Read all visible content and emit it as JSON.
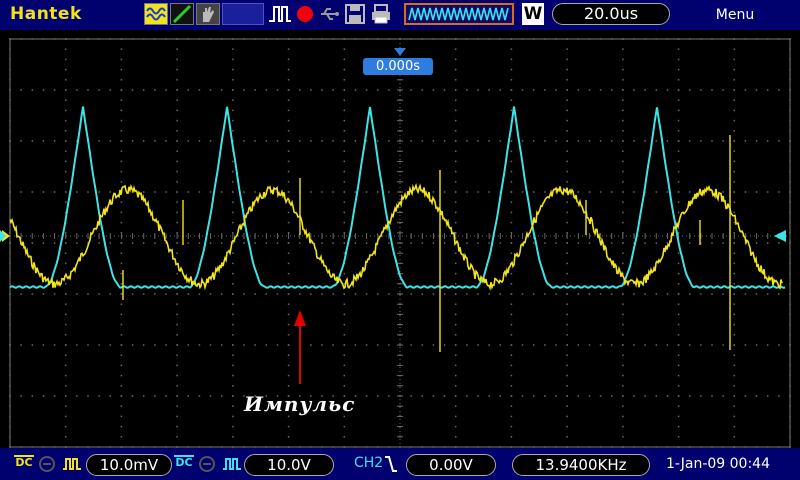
{
  "topbar": {
    "brand": "Hantek",
    "icons": [
      "waveform-icon",
      "line-mode-icon",
      "hand-icon",
      "display-icon",
      "pulse-icon",
      "record-icon",
      "usb-icon",
      "save-icon",
      "print-icon",
      "memory-depth-icon",
      "waveform-w-icon"
    ],
    "w_label": "W",
    "timebase": "20.0us",
    "menu_label": "Menu"
  },
  "screen": {
    "trigger_time": "0.000s",
    "annotation": "Импульс",
    "colors": {
      "ch1": "#f1e41c",
      "ch2": "#3ee3e6",
      "annotation_arrow": "#e30000",
      "trigger_marker": "#2f7ce0"
    }
  },
  "bottombar": {
    "ch1_coupling": "DC",
    "ch1_scale": "10.0mV",
    "ch2_coupling": "DC",
    "ch2_scale": "10.0V",
    "trigger_source": "CH2",
    "trigger_level": "0.00V",
    "frequency": "13.9400KHz",
    "datetime": "1-Jan-09 00:44"
  }
}
